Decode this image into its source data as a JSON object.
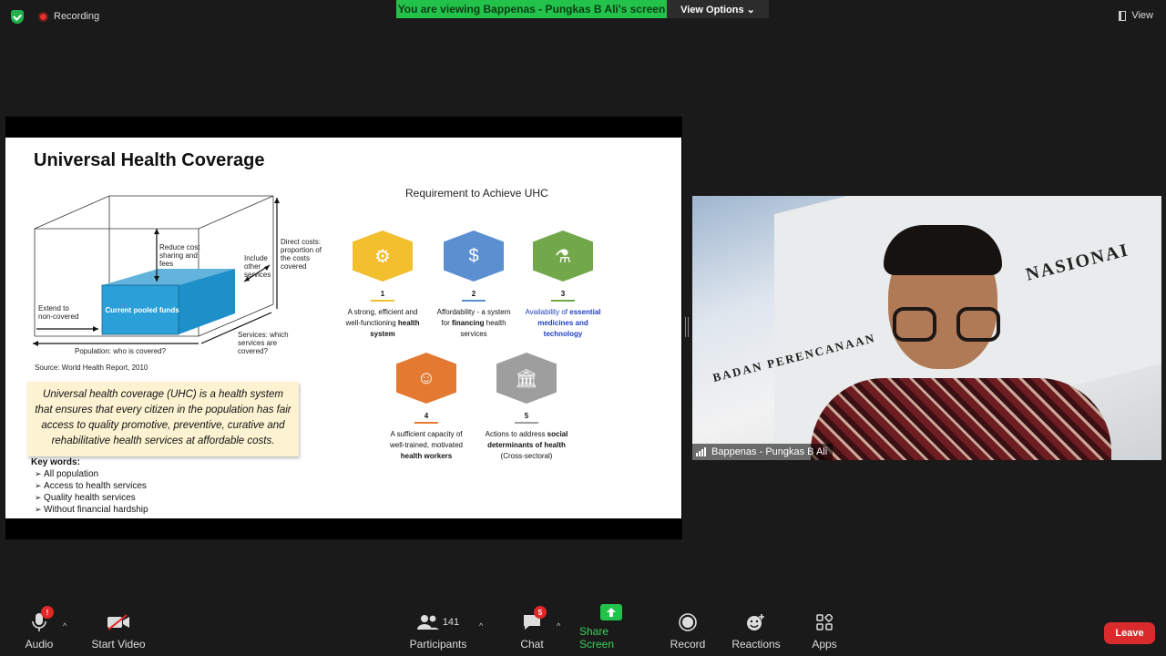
{
  "topbar": {
    "recording_label": "Recording",
    "banner_text": "You are viewing Bappenas - Pungkas B Ali's screen",
    "view_options_label": "View Options ⌄",
    "view_label": "View"
  },
  "slide": {
    "title": "Universal Health Coverage",
    "subtitle": "Requirement to Achieve UHC",
    "diagram_labels": {
      "reduce": "Reduce cost sharing and fees",
      "direct": "Direct costs: proportion of the costs covered",
      "include": "Include other services",
      "extend": "Extend to non-covered",
      "pooled": "Current pooled funds",
      "population": "Population: who is covered?",
      "services": "Services: which services are covered?"
    },
    "source": "Source: World Health Report, 2010",
    "quote": "Universal health coverage (UHC) is a health system that ensures that every citizen in the population has fair access to quality promotive, preventive, curative and rehabilitative health services at affordable costs.",
    "keywords_title": "Key words:",
    "keywords": [
      "All population",
      "Access to health services",
      "Quality health services",
      "Without financial hardship"
    ],
    "requirements": [
      {
        "num": "1",
        "pre": "A strong, efficient and well-functioning ",
        "bold": "health system",
        "post": ""
      },
      {
        "num": "2",
        "pre": "Affordability - a system for ",
        "bold": "financing",
        "post": " health services"
      },
      {
        "num": "3",
        "pre": "Availability of ",
        "bold": "essential medicines and technology",
        "post": ""
      },
      {
        "num": "4",
        "pre": "A sufficient capacity of well-trained, motivated ",
        "bold": "health workers",
        "post": ""
      },
      {
        "num": "5",
        "pre": "Actions to address ",
        "bold": "social determinants of health",
        "post": " (Cross-sectoral)"
      }
    ],
    "colors": {
      "hex1": "#f2bf2e",
      "hex2": "#5b8fd0",
      "hex3": "#72a84a",
      "hex4": "#e47a32",
      "hex5": "#9e9e9e",
      "blue_text": "#1f3fc4"
    }
  },
  "video": {
    "participant_name": "Bappenas - Pungkas B Ali",
    "sign_top": "NASIONAI",
    "sign_bottom": "BADAN PERENCANAAN"
  },
  "toolbar": {
    "audio": "Audio",
    "audio_badge": "!",
    "video": "Start Video",
    "participants": "Participants",
    "participants_count": "141",
    "chat": "Chat",
    "chat_badge": "5",
    "share": "Share Screen",
    "record": "Record",
    "reactions": "Reactions",
    "apps": "Apps",
    "leave": "Leave"
  }
}
